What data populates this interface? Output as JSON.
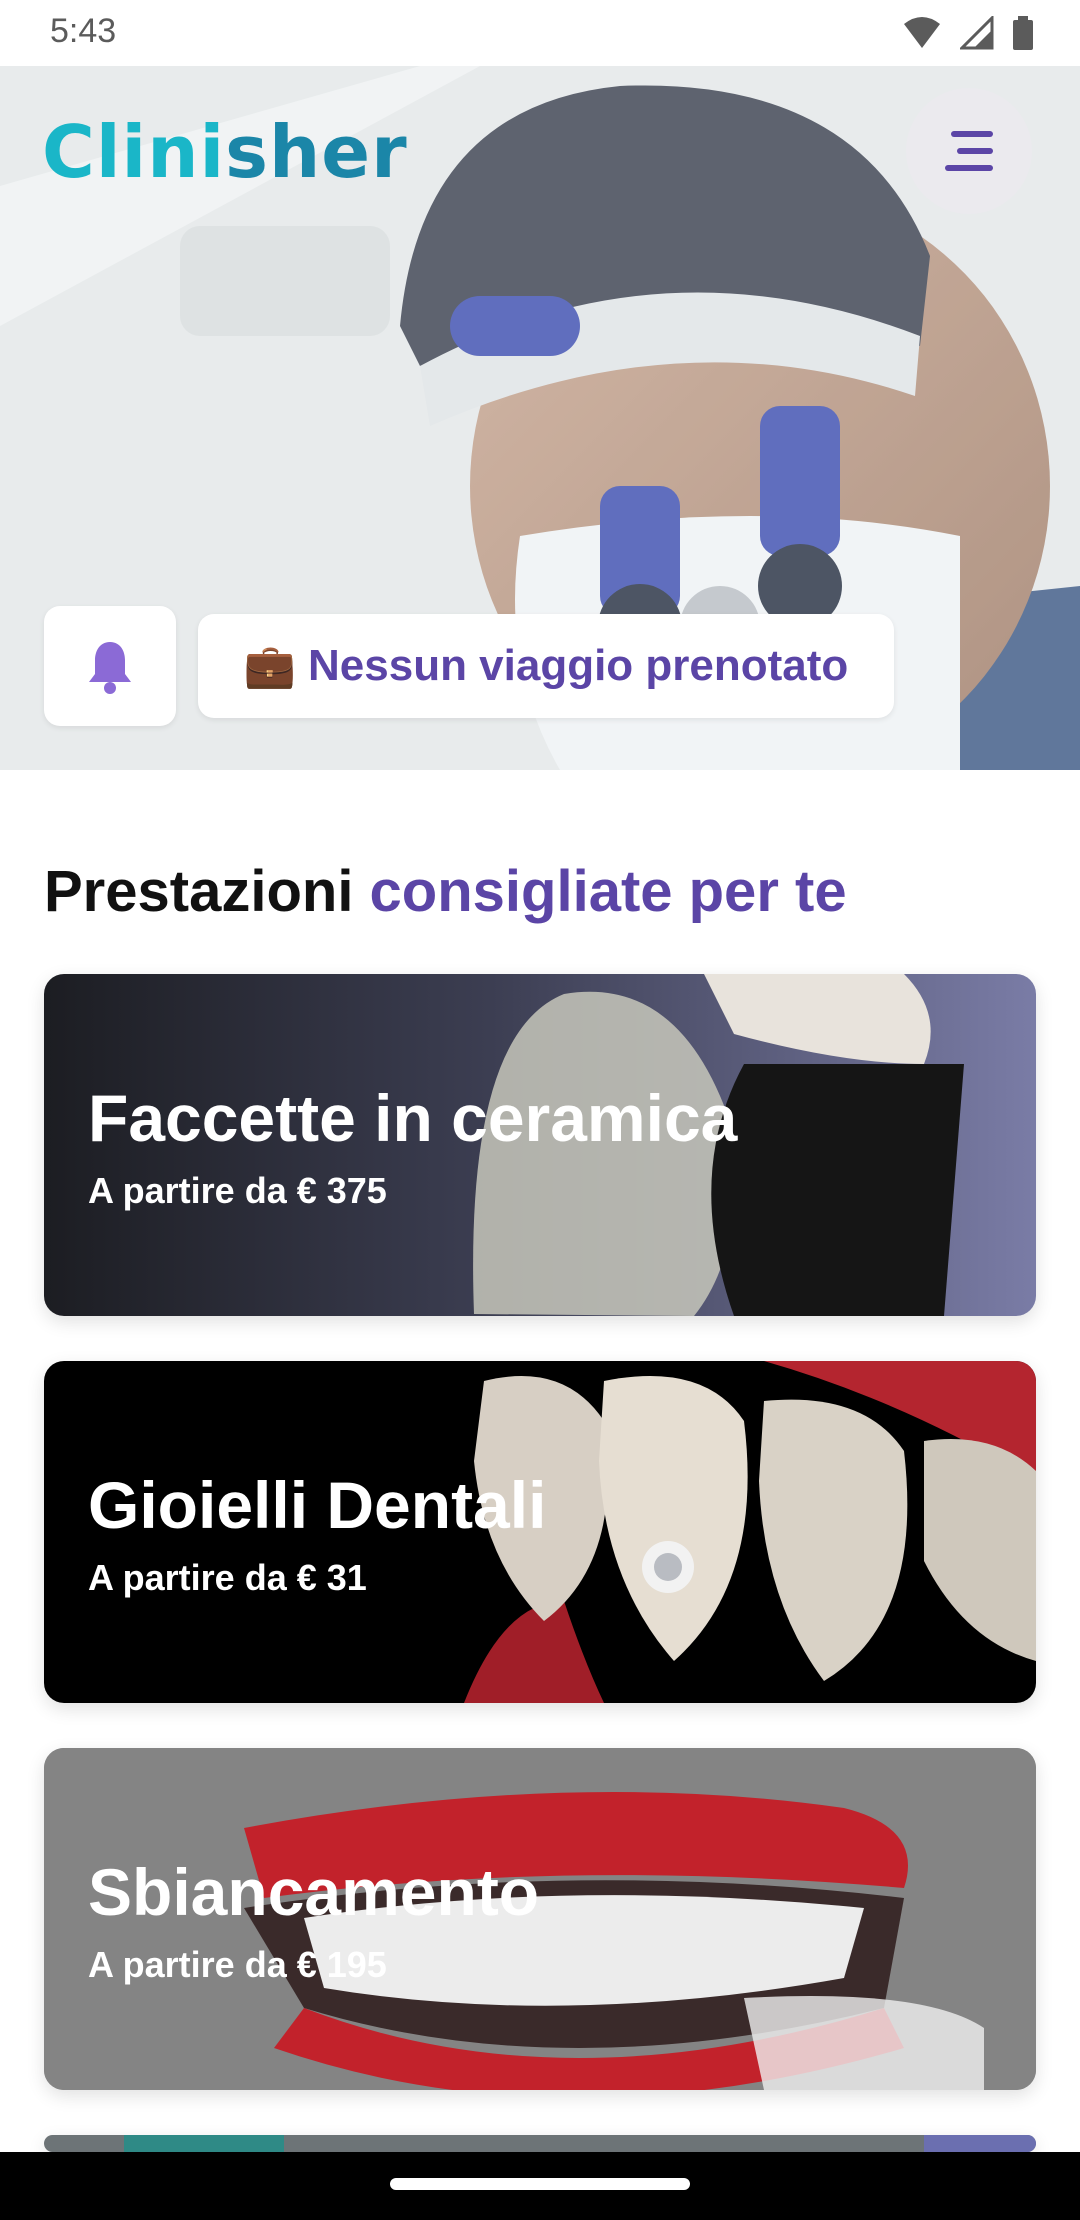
{
  "status_bar": {
    "time": "5:43"
  },
  "header": {
    "logo_prefix": "Clini",
    "logo_suffix": "sher",
    "brand_color": "#1ab6c8"
  },
  "hero": {
    "trip_emoji": "💼",
    "trip_label": "Nessun viaggio prenotato"
  },
  "section": {
    "title_plain": "Prestazioni ",
    "title_highlight": "consigliate per te",
    "accent_color": "#5b45a6"
  },
  "cards": [
    {
      "title": "Faccette in ceramica",
      "price": "A partire da € 375"
    },
    {
      "title": "Gioielli Dentali",
      "price": "A partire da € 31"
    },
    {
      "title": "Sbiancamento",
      "price": "A partire da € 195"
    }
  ]
}
